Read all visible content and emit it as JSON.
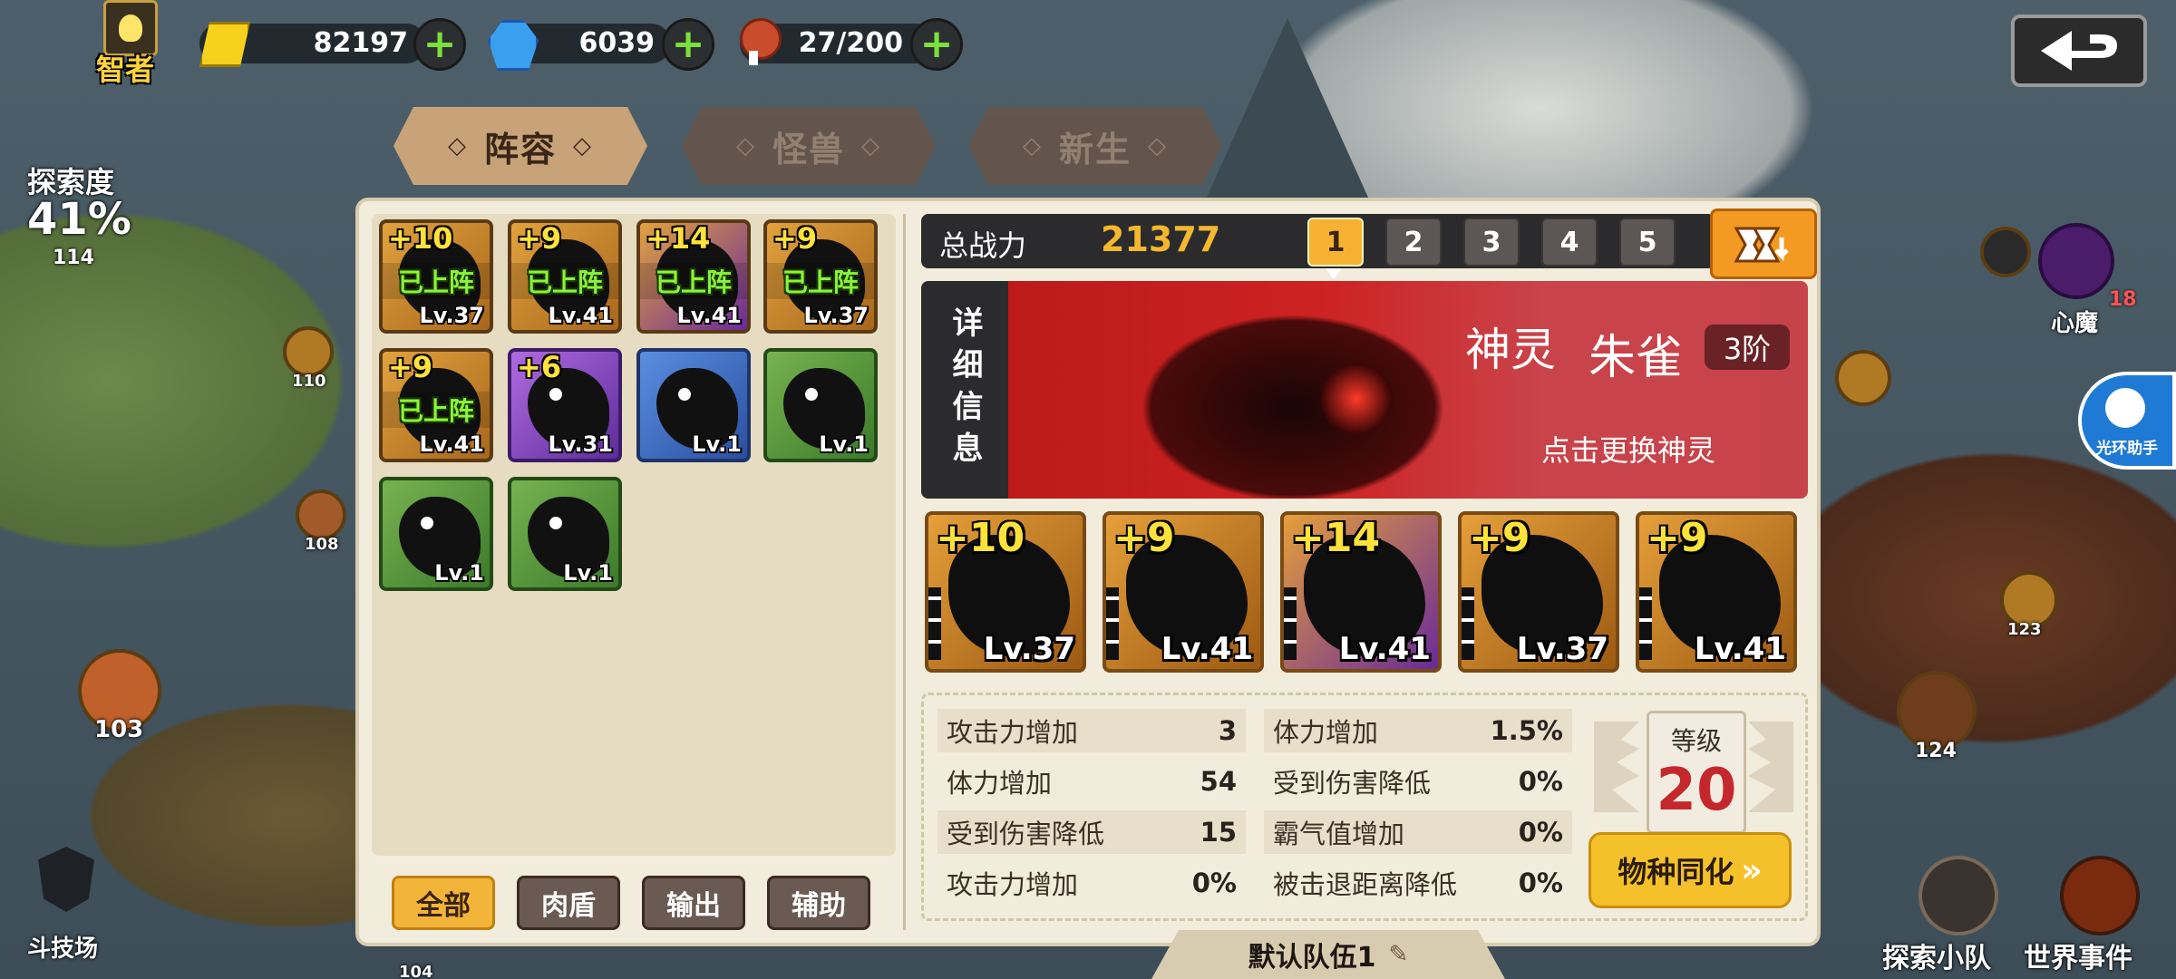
{
  "topbar": {
    "rank_label": "智者",
    "gold": "82197",
    "gems": "6039",
    "stamina": "27/200"
  },
  "tabs": [
    {
      "label": "阵容",
      "active": true
    },
    {
      "label": "怪兽",
      "active": false
    },
    {
      "label": "新生",
      "active": false
    }
  ],
  "map": {
    "explore_label": "探索度",
    "explore_pct": "41%",
    "explore_num": "114",
    "nodes": [
      "110",
      "108",
      "103",
      "104",
      "124",
      "123"
    ],
    "arena_label": "斗技场",
    "heart_demon_label": "心魔",
    "heart_demon_count": "18",
    "assistant_label": "光环助手",
    "explore_team_label": "探索小队",
    "world_event_label": "世界事件"
  },
  "roster": {
    "deployed_label": "已上阵",
    "cards": [
      {
        "plus": "+10",
        "level": "Lv.37",
        "deployed": true,
        "color": "gold"
      },
      {
        "plus": "+9",
        "level": "Lv.41",
        "deployed": true,
        "color": "gold"
      },
      {
        "plus": "+14",
        "level": "Lv.41",
        "deployed": true,
        "color": "gold"
      },
      {
        "plus": "+9",
        "level": "Lv.37",
        "deployed": true,
        "color": "gold"
      },
      {
        "plus": "+9",
        "level": "Lv.41",
        "deployed": true,
        "color": "gold"
      },
      {
        "plus": "+6",
        "level": "Lv.31",
        "deployed": false,
        "color": "purple"
      },
      {
        "plus": "",
        "level": "Lv.1",
        "deployed": false,
        "color": "blue"
      },
      {
        "plus": "",
        "level": "Lv.1",
        "deployed": false,
        "color": "green"
      },
      {
        "plus": "",
        "level": "Lv.1",
        "deployed": false,
        "color": "green"
      },
      {
        "plus": "",
        "level": "Lv.1",
        "deployed": false,
        "color": "green"
      }
    ],
    "filters": [
      {
        "label": "全部",
        "active": true
      },
      {
        "label": "肉盾",
        "active": false
      },
      {
        "label": "输出",
        "active": false
      },
      {
        "label": "辅助",
        "active": false
      }
    ]
  },
  "team": {
    "power_label": "总战力",
    "power_value": "21377",
    "slots": [
      "1",
      "2",
      "3",
      "4",
      "5"
    ],
    "active_slot": "1",
    "detail_tab": "详细信息",
    "deity_prefix": "神灵",
    "deity_name": "朱雀",
    "deity_rank": "3阶",
    "deity_change_hint": "点击更换神灵",
    "members": [
      {
        "plus": "+10",
        "level": "Lv.37"
      },
      {
        "plus": "+9",
        "level": "Lv.41"
      },
      {
        "plus": "+14",
        "level": "Lv.41"
      },
      {
        "plus": "+9",
        "level": "Lv.37"
      },
      {
        "plus": "+9",
        "level": "Lv.41"
      }
    ],
    "stats_left": [
      {
        "label": "攻击力增加",
        "value": "3"
      },
      {
        "label": "体力增加",
        "value": "54"
      },
      {
        "label": "受到伤害降低",
        "value": "15"
      },
      {
        "label": "攻击力增加",
        "value": "0%"
      }
    ],
    "stats_right": [
      {
        "label": "体力增加",
        "value": "1.5%"
      },
      {
        "label": "受到伤害降低",
        "value": "0%"
      },
      {
        "label": "霸气值增加",
        "value": "0%"
      },
      {
        "label": "被击退距离降低",
        "value": "0%"
      }
    ],
    "level_label": "等级",
    "level_value": "20",
    "sync_label": "物种同化",
    "team_name": "默认队伍1"
  },
  "colors": {
    "accent": "#f7b234",
    "plus_green": "#7be03a",
    "deployed_green": "#8cf23a",
    "banner_red": "#c62020",
    "power_gold": "#f4b82e"
  }
}
